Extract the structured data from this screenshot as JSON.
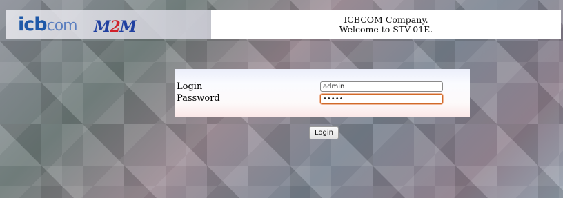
{
  "header": {
    "logo_icb_text": "icb",
    "logo_icb_text2": "com",
    "logo_m2m_text_a": "M",
    "logo_m2m_text_b": "2",
    "logo_m2m_text_c": "M",
    "welcome_line1": "ICBCOM Company.",
    "welcome_line2": "Welcome to STV-01E."
  },
  "form": {
    "login_label": "Login",
    "password_label": "Password",
    "login_value": "admin",
    "password_value": "•••••"
  },
  "actions": {
    "login_button": "Login"
  },
  "colors": {
    "brand_blue": "#1e58a8",
    "brand_red": "#d0202a"
  }
}
